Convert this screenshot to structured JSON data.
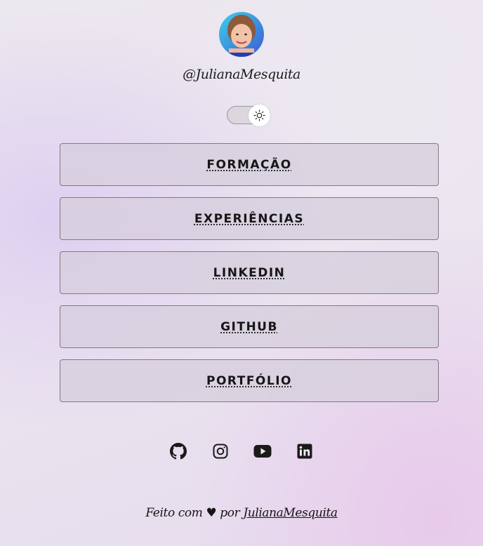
{
  "profile": {
    "username": "@JulianaMesquita"
  },
  "theme_toggle": {
    "icon": "sun-icon",
    "state": "light"
  },
  "links": [
    {
      "label": "FORMAÇÃO",
      "name": "formacao-button"
    },
    {
      "label": "EXPERIÊNCIAS",
      "name": "experiencias-button"
    },
    {
      "label": "LINKEDIN",
      "name": "linkedin-button"
    },
    {
      "label": "GITHUB",
      "name": "github-button"
    },
    {
      "label": "PORTFÓLIO",
      "name": "portfolio-button"
    }
  ],
  "social": [
    {
      "icon": "github-icon"
    },
    {
      "icon": "instagram-icon"
    },
    {
      "icon": "youtube-icon"
    },
    {
      "icon": "linkedin-icon"
    }
  ],
  "footer": {
    "prefix": "Feito com ♥ por ",
    "author_link": "JulianaMesquita"
  },
  "colors": {
    "text": "#161616",
    "button_bg": "#d6cedc",
    "button_border": "#7f7a84"
  }
}
